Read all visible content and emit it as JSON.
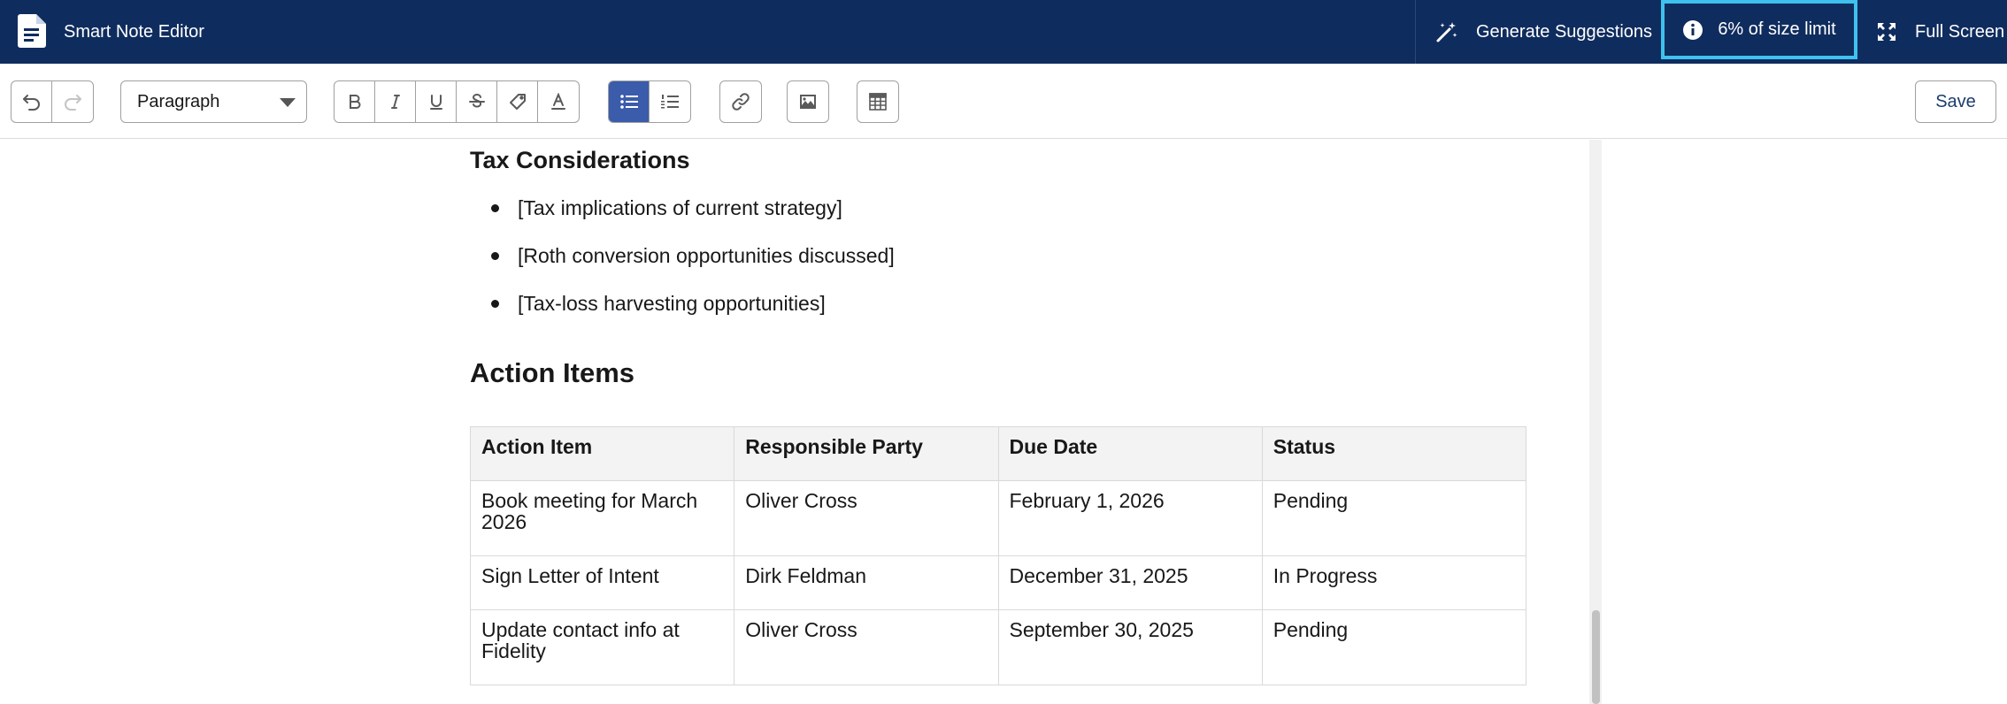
{
  "header": {
    "app_icon": "document-icon",
    "title": "Smart Note Editor",
    "generate_label": "Generate Suggestions",
    "generate_icon": "magic-wand-icon",
    "size_limit_label": "6% of size limit",
    "size_limit_icon": "info-icon",
    "fullscreen_label": "Full Screen",
    "fullscreen_icon": "expand-icon",
    "colors": {
      "background": "#0f2c5e",
      "highlight_border": "#3fc1ef"
    }
  },
  "toolbar": {
    "history_icons": [
      "undo-icon",
      "redo-icon"
    ],
    "format_select": {
      "value": "Paragraph"
    },
    "text_format_icons": [
      "bold-icon",
      "italic-icon",
      "underline-icon",
      "strikethrough-icon",
      "clear-format-icon",
      "text-color-icon"
    ],
    "list_icons": [
      "bulleted-list-icon",
      "numbered-list-icon"
    ],
    "active_list": "bulleted-list-icon",
    "insert_icons": [
      "link-icon",
      "image-icon",
      "table-icon"
    ],
    "save_label": "Save",
    "colors": {
      "active": "#3b5bab"
    }
  },
  "document": {
    "tax_heading": "Tax Considerations",
    "tax_items": [
      "[Tax implications of current strategy]",
      "[Roth conversion opportunities discussed]",
      "[Tax-loss harvesting opportunities]"
    ],
    "actions_heading": "Action Items",
    "actions_table": {
      "headers": [
        "Action Item",
        "Responsible Party",
        "Due Date",
        "Status"
      ],
      "rows": [
        [
          "Book meeting for March 2026",
          "Oliver Cross",
          "February 1, 2026",
          "Pending"
        ],
        [
          "Sign Letter of Intent",
          "Dirk Feldman",
          "December 31, 2025",
          "In Progress"
        ],
        [
          "Update contact info at Fidelity",
          "Oliver Cross",
          "September 30, 2025",
          "Pending"
        ]
      ]
    }
  }
}
